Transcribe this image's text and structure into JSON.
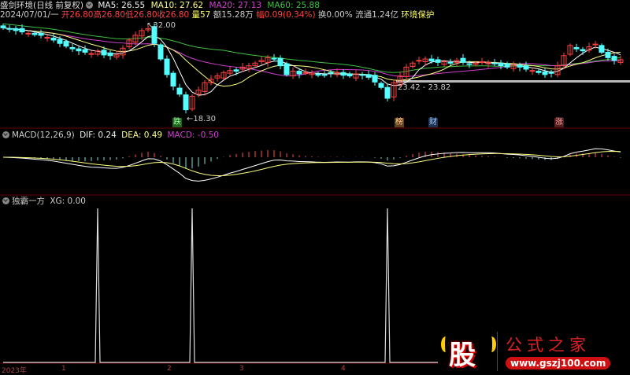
{
  "header": {
    "title": "盛剑环境(日线 前复权)",
    "ma5": "MA5: 26.55",
    "ma10": "MA10: 27.62",
    "ma20": "MA20: 27.13",
    "ma60": "MA60: 25.88"
  },
  "info": {
    "date": "2024/07/01/一",
    "open": "开26.80",
    "high": "高26.80",
    "low": "低26.80",
    "close": "收26.80",
    "volume": "量57",
    "amount": "额15.28万",
    "change": "幅0.09(0.34%)",
    "turnover": "换0.00%",
    "float": "流通1.24亿",
    "sector": "环境保护"
  },
  "annotations": {
    "high": "32.00",
    "low": "18.30",
    "zone": "23.42 - 23.82",
    "badge_die": "跌",
    "badge_bang": "榜",
    "badge_cai": "财",
    "badge_zhang": "涨"
  },
  "macd": {
    "label": "MACD(12,26,9)",
    "dif": "DIF: 0.24",
    "dea": "DEA: 0.49",
    "macd": "MACD: -0.50"
  },
  "xg": {
    "label": "独霸一方",
    "xg": "XG: 0.00",
    "signal_indices": [
      15,
      30,
      61
    ]
  },
  "time_axis": [
    "2023年",
    "1",
    "2",
    "3",
    "4"
  ],
  "logo": {
    "char": "股",
    "name": "公式之家",
    "url": "www.gszj100.com"
  },
  "colors": {
    "up": "#ff4040",
    "down": "#54ffff",
    "ma5": "#ffffff",
    "ma10": "#ffff80",
    "ma20": "#d040d0",
    "ma60": "#40c040"
  },
  "chart_data": {
    "type": "candlestick",
    "closes": [
      31.6,
      31.4,
      31.2,
      31.0,
      30.8,
      30.6,
      30.5,
      30.2,
      29.8,
      29.3,
      28.9,
      28.5,
      28.2,
      28.0,
      27.8,
      28.2,
      27.6,
      27.5,
      27.6,
      28.6,
      29.8,
      30.5,
      31.2,
      31.5,
      29.3,
      27.0,
      24.7,
      23.0,
      21.8,
      19.5,
      21.5,
      22.4,
      23.5,
      24.0,
      24.5,
      25.0,
      25.3,
      25.2,
      25.8,
      26.0,
      26.4,
      26.8,
      27.2,
      27.0,
      26.0,
      24.7,
      25.2,
      24.8,
      25.0,
      24.9,
      24.6,
      24.7,
      24.9,
      25.0,
      24.6,
      24.5,
      24.8,
      24.6,
      24.3,
      23.6,
      22.8,
      21.2,
      23.5,
      24.5,
      25.8,
      26.4,
      26.8,
      27.0,
      26.7,
      26.5,
      26.6,
      26.4,
      26.8,
      26.5,
      26.2,
      26.4,
      26.6,
      26.5,
      26.3,
      26.0,
      25.8,
      26.1,
      25.8,
      25.5,
      25.3,
      25.0,
      24.7,
      24.9,
      26.0,
      27.5,
      29.0,
      28.5,
      28.2,
      28.8,
      29.2,
      28.0,
      27.2,
      26.8,
      26.9
    ]
  }
}
